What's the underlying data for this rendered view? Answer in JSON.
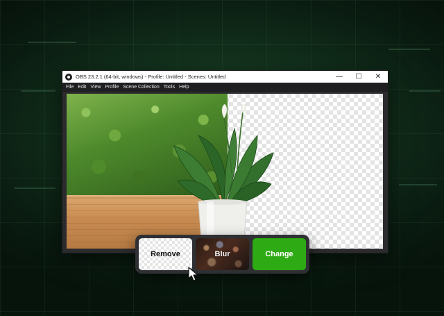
{
  "window": {
    "title": "OBS 23.2.1 (64-bit, windows) - Profile: Untitled - Scenes: Untitled",
    "controls": {
      "minimize": "—",
      "maximize": "☐",
      "close": "✕"
    }
  },
  "menu": [
    "File",
    "Edit",
    "View",
    "Profile",
    "Scene Collection",
    "Tools",
    "Help"
  ],
  "effects": {
    "remove_label": "Remove",
    "blur_label": "Blur",
    "change_label": "Change"
  },
  "colors": {
    "accent_green": "#2eaa14",
    "window_dark": "#2b2b2e"
  },
  "icons": {
    "app": "obs-logo-icon",
    "cursor": "mouse-pointer-icon"
  }
}
